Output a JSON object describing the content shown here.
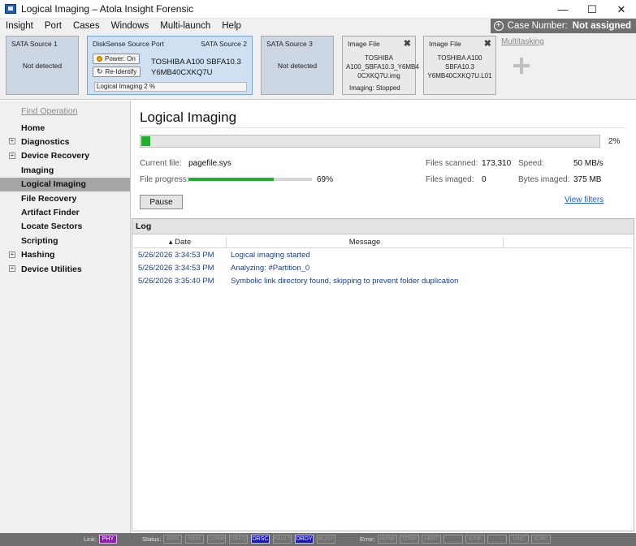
{
  "window": {
    "title": "Logical Imaging – Atola Insight Forensic",
    "minimize": "—",
    "maximize": "☐",
    "close": "✕"
  },
  "menu": {
    "items": [
      "Insight",
      "Port",
      "Cases",
      "Windows",
      "Multi-launch",
      "Help"
    ],
    "case_label": "Case Number:",
    "case_value": "Not assigned"
  },
  "devices": {
    "sata1": {
      "name": "SATA Source 1",
      "status": "Not detected"
    },
    "disksense": {
      "name": "DiskSense Source Port",
      "port": "SATA Source 2",
      "power_label": "Power: On",
      "reidentify_label": "Re-Identify",
      "model_line1": "TOSHIBA A100 SBFA10.3",
      "model_line2": "Y6MB40CXKQ7U",
      "progress_text": "Logical Imaging  2 %"
    },
    "sata3": {
      "name": "SATA Source 3",
      "status": "Not detected"
    },
    "image1": {
      "name": "Image File",
      "line1": "TOSHIBA",
      "line2": "A100_SBFA10.3_Y6MB4",
      "line3": "0CXKQ7U.img",
      "status": "Imaging: Stopped"
    },
    "image2": {
      "name": "Image File",
      "line1": "TOSHIBA A100",
      "line2": "SBFA10.3",
      "line3": "Y6MB40CXKQ7U.L01"
    },
    "multitasking": "Multitasking"
  },
  "sidebar": {
    "find_operation": "Find Operation",
    "items": [
      {
        "label": "Home"
      },
      {
        "label": "Diagnostics"
      },
      {
        "label": "Device Recovery"
      },
      {
        "label": "Imaging"
      },
      {
        "label": "Logical Imaging"
      },
      {
        "label": "File Recovery"
      },
      {
        "label": "Artifact Finder"
      },
      {
        "label": "Locate Sectors"
      },
      {
        "label": "Scripting"
      },
      {
        "label": "Hashing"
      },
      {
        "label": "Device Utilities"
      }
    ]
  },
  "main": {
    "title": "Logical Imaging",
    "overall_progress": 0.02,
    "overall_percent": "2%",
    "current_file_label": "Current file:",
    "current_file": "pagefile.sys",
    "file_progress_label": "File progress:",
    "file_progress": 0.69,
    "file_progress_percent": "69%",
    "files_scanned_label": "Files scanned:",
    "files_scanned": "173,310",
    "files_imaged_label": "Files imaged:",
    "files_imaged": "0",
    "speed_label": "Speed:",
    "speed": "50 MB/s",
    "bytes_imaged_label": "Bytes imaged:",
    "bytes_imaged": "375 MB",
    "pause_label": "Pause",
    "view_filters_label": "View filters"
  },
  "log": {
    "title": "Log",
    "col_date": "▴ Date",
    "col_message": "Message",
    "rows": [
      {
        "date": "5/26/2026 3:34:53 PM",
        "message": "Logical imaging started"
      },
      {
        "date": "5/26/2026 3:34:53 PM",
        "message": "Analyzing: #Partition_0"
      },
      {
        "date": "5/26/2026 3:35:40 PM",
        "message": "Symbolic link directory found, skipping to prevent folder duplication"
      }
    ]
  },
  "statusbar": {
    "link_label": "Link:",
    "link_value": "PHY",
    "status_label": "Status:",
    "status_flags": [
      "ERR",
      "INDX",
      "CORR",
      "DREQ",
      "DRSC",
      "FAULT",
      "DRDY",
      "BUSY"
    ],
    "status_active": [
      "DRSC",
      "DRDY"
    ],
    "error_label": "Error:",
    "error_flags": [
      "AMNF",
      "TONF",
      "ABRT",
      "",
      "IDNF",
      "",
      "UNC",
      "ICRC"
    ]
  },
  "colors": {
    "progress": "#1fae2d",
    "link": "#1e5ed6",
    "log_text": "#1b3f8a",
    "selected_nav": "#a6a6a6"
  }
}
